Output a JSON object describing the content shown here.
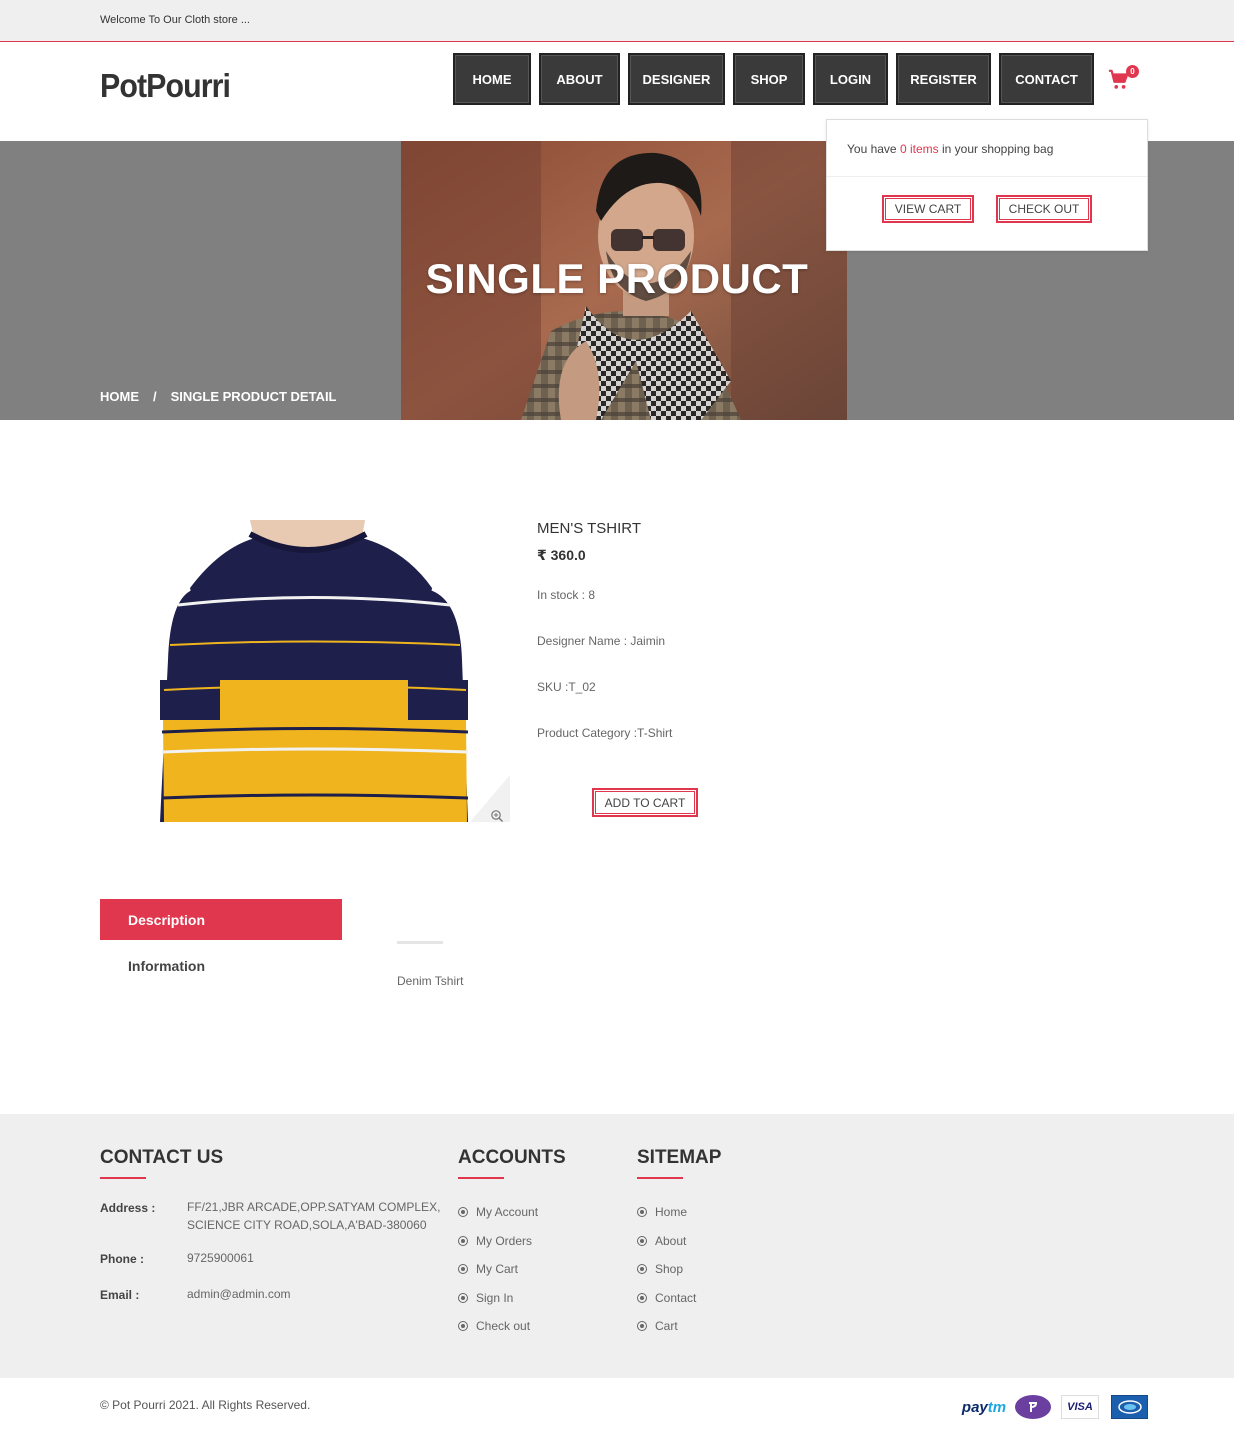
{
  "topbar": {
    "welcome": "Welcome To Our Cloth store ..."
  },
  "header": {
    "logo": "PotPourri",
    "nav": [
      "HOME",
      "ABOUT",
      "DESIGNER",
      "SHOP",
      "LOGIN",
      "REGISTER",
      "CONTACT"
    ],
    "cart_count": "0"
  },
  "banner": {
    "title": "SINGLE PRODUCT",
    "breadcrumb": {
      "home": "HOME",
      "separator": "/",
      "current": "SINGLE PRODUCT DETAIL"
    }
  },
  "minicart": {
    "msg_prefix": "You have",
    "items": "0 items",
    "msg_suffix": "in your shopping bag",
    "view_cart": "VIEW CART",
    "check_out": "CHECK OUT"
  },
  "product": {
    "name": "MEN'S TSHIRT",
    "price": "₹ 360.0",
    "stock": "In stock : 8",
    "designer": "Designer Name : Jaimin",
    "sku": "SKU :T_02",
    "category": "Product Category :T-Shirt",
    "add_to_cart": "ADD TO CART"
  },
  "tabs": {
    "description": "Description",
    "information": "Information",
    "content": "Denim Tshirt"
  },
  "footer": {
    "contact": {
      "heading": "CONTACT US",
      "address_label": "Address :",
      "address_line1": "FF/21,JBR ARCADE,OPP.SATYAM COMPLEX,",
      "address_line2": "SCIENCE CITY ROAD,SOLA,A'BAD-380060",
      "phone_label": "Phone :",
      "phone": "9725900061",
      "email_label": "Email :",
      "email": "admin@admin.com"
    },
    "accounts": {
      "heading": "ACCOUNTS",
      "links": [
        "My Account",
        "My Orders",
        "My Cart",
        "Sign In",
        "Check out"
      ]
    },
    "sitemap": {
      "heading": "SITEMAP",
      "links": [
        "Home",
        "About",
        "Shop",
        "Contact",
        "Cart"
      ]
    },
    "copyright": "© Pot Pourri 2021. All Rights Reserved.",
    "payment_icons": [
      "paytm-icon",
      "phonepe-icon",
      "visa-icon",
      "citrus-icon"
    ]
  },
  "colors": {
    "accent": "#e0374f",
    "nav_bg": "#3a3a3a",
    "banner_bg": "#808080"
  }
}
